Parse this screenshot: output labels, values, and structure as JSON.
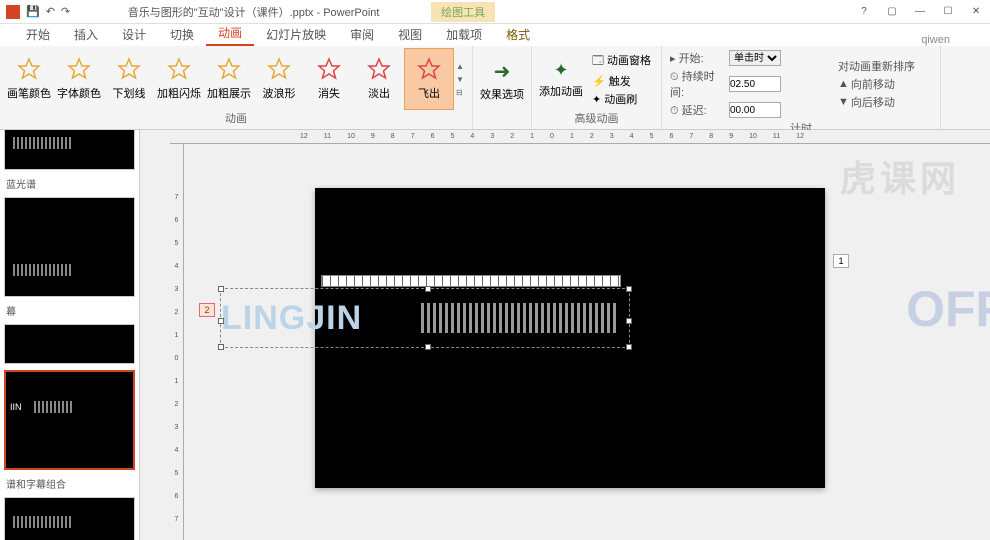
{
  "titlebar": {
    "filename": "音乐与图形的\"互动\"设计（课件）.pptx - PowerPoint",
    "contextual_tab": "绘图工具",
    "user": "qiwen"
  },
  "tabs": {
    "items": [
      "开始",
      "插入",
      "设计",
      "切换",
      "动画",
      "幻灯片放映",
      "审阅",
      "视图",
      "加载项",
      "格式"
    ],
    "active_index": 4
  },
  "ribbon": {
    "animations": [
      {
        "label": "画笔颜色",
        "color": "#e8a838"
      },
      {
        "label": "字体颜色",
        "color": "#e8a838"
      },
      {
        "label": "下划线",
        "color": "#e8a838"
      },
      {
        "label": "加粗闪烁",
        "color": "#e8a838"
      },
      {
        "label": "加粗展示",
        "color": "#e8a838"
      },
      {
        "label": "波浪形",
        "color": "#e8a838"
      },
      {
        "label": "消失",
        "color": "#d44"
      },
      {
        "label": "淡出",
        "color": "#d44"
      },
      {
        "label": "飞出",
        "color": "#d44"
      }
    ],
    "active_anim": 8,
    "effect_options": "效果选项",
    "add_anim": "添加动画",
    "anim_pane": "动画窗格",
    "trigger": "触发",
    "anim_painter": "动画刷",
    "start_label": "开始:",
    "start_value": "单击时",
    "duration_label": "持续时间:",
    "duration_value": "02.50",
    "delay_label": "延迟:",
    "delay_value": "00.00",
    "reorder_label": "对动画重新排序",
    "move_earlier": "向前移动",
    "move_later": "向后移动",
    "group_anim": "动画",
    "group_adv": "高级动画",
    "group_timing": "计时"
  },
  "ruler_h": [
    "12",
    "11",
    "10",
    "9",
    "8",
    "7",
    "6",
    "5",
    "4",
    "3",
    "2",
    "1",
    "0",
    "1",
    "2",
    "3",
    "4",
    "5",
    "6",
    "7",
    "8",
    "9",
    "10",
    "11",
    "12"
  ],
  "ruler_v": [
    "7",
    "6",
    "5",
    "4",
    "3",
    "2",
    "1",
    "0",
    "1",
    "2",
    "3",
    "4",
    "5",
    "6",
    "7"
  ],
  "thumbnails": {
    "items": [
      {
        "label": "蓝光谱"
      },
      {
        "label": "幕"
      },
      {
        "label": ""
      },
      {
        "label": "谱和字幕组合"
      }
    ],
    "selected": 2
  },
  "slide": {
    "badge": "1",
    "anim_tag": "2",
    "text": "LINGJIN",
    "mini_ruler_end": "2"
  },
  "watermark": {
    "right": "OFFI",
    "top": "虎课网"
  }
}
